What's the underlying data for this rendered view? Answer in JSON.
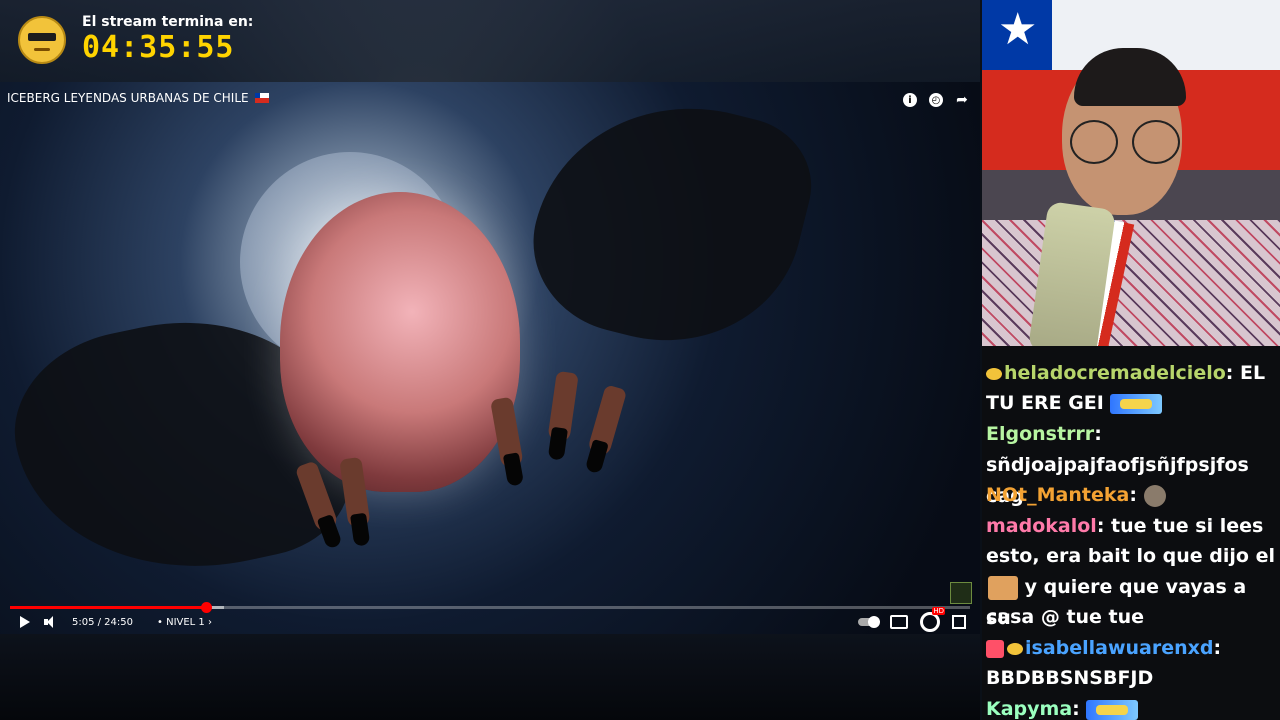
{
  "timer": {
    "label": "El stream termina en:",
    "value": "04:35:55"
  },
  "video": {
    "title": "ICEBERG LEYENDAS URBANAS DE CHILE",
    "time": "5:05 / 24:50",
    "chapter": "NIVEL 1",
    "progress_fraction": 0.2044,
    "buffer_fraction": 0.2232
  },
  "chat": {
    "messages": [
      {
        "user": "heladocremadelcielo",
        "user_color": "#b7d56b",
        "sep": ":",
        "text": "EL"
      },
      {
        "user": "",
        "user_color": "",
        "sep": "",
        "text": "TU ERE GEI"
      },
      {
        "user": "Elgonstrrr",
        "user_color": "#b7f5a2",
        "sep": ":",
        "text": ""
      },
      {
        "user": "",
        "user_color": "",
        "sep": "",
        "text": "sñdjoajpajfaofjsñjfpsjfos cag"
      },
      {
        "user": "NOt_Manteka",
        "user_color": "#f3a233",
        "sep": ":",
        "text": ""
      },
      {
        "user": "madokalol",
        "user_color": "#ff7aa9",
        "sep": ":",
        "text": "tue tue si lees"
      },
      {
        "user": "",
        "user_color": "",
        "sep": "",
        "text": "esto, era bait lo que dijo el"
      },
      {
        "user": "",
        "user_color": "",
        "sep": "",
        "text": "y quiere que vayas a su"
      },
      {
        "user": "",
        "user_color": "",
        "sep": "",
        "text": "casa @ tue tue"
      },
      {
        "user": "isabellawuarenxd",
        "user_color": "#4aa3ff",
        "sep": ":",
        "text": ""
      },
      {
        "user": "",
        "user_color": "",
        "sep": "",
        "text": "BBDBBSNSBFJD"
      },
      {
        "user": "Kapyma",
        "user_color": "#9bffbf",
        "sep": ":",
        "text": ""
      }
    ]
  }
}
